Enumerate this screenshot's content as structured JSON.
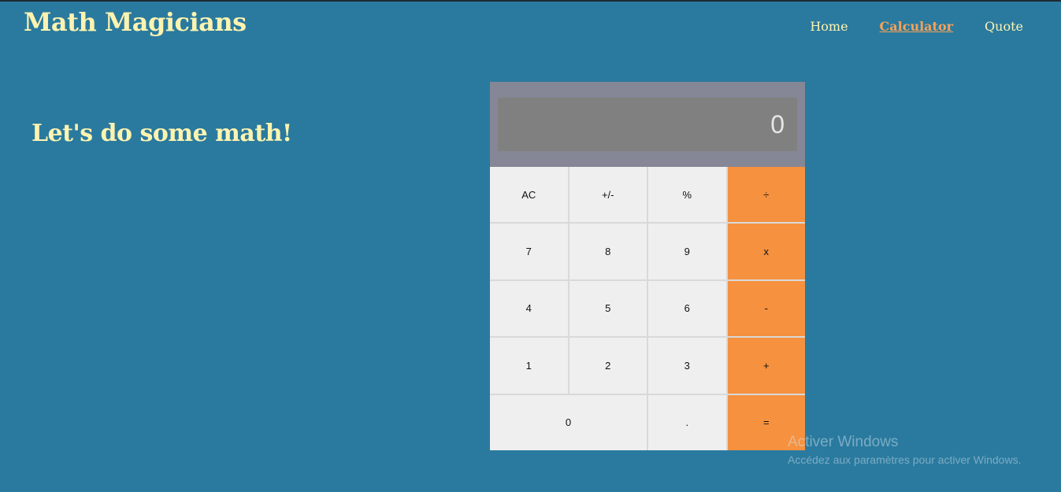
{
  "header": {
    "brand": "Math Magicians",
    "nav": [
      {
        "label": "Home"
      },
      {
        "label": "Calculator"
      },
      {
        "label": "Quote"
      }
    ]
  },
  "main": {
    "headline": "Let's do some math!"
  },
  "calculator": {
    "display": "0",
    "keys": [
      "AC",
      "+/-",
      "%",
      "÷",
      "7",
      "8",
      "9",
      "x",
      "4",
      "5",
      "6",
      "-",
      "1",
      "2",
      "3",
      "+",
      "0",
      ".",
      "="
    ]
  },
  "watermark": {
    "title": "Activer Windows",
    "subtitle": "Accédez aux paramètres pour activer Windows."
  },
  "colors": {
    "background": "#2a7a9f",
    "accent": "#fdf3b0",
    "active_link": "#f4a259",
    "operator": "#f5913f"
  }
}
